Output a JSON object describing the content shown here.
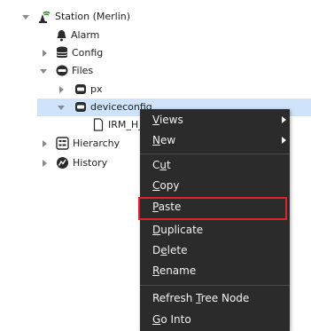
{
  "tree": {
    "station": "Station (Merlin)",
    "alarm": "Alarm",
    "config": "Config",
    "files": "Files",
    "px": "px",
    "deviceconfig": "deviceconfig",
    "irm_file": "IRM_H_",
    "hierarchy": "Hierarchy",
    "history": "History"
  },
  "menu": {
    "views": {
      "pre": "",
      "u": "V",
      "post": "iews"
    },
    "new": {
      "pre": "",
      "u": "N",
      "post": "ew"
    },
    "cut": {
      "pre": "C",
      "u": "u",
      "post": "t"
    },
    "copy": {
      "pre": "",
      "u": "C",
      "post": "opy"
    },
    "paste": {
      "pre": "",
      "u": "P",
      "post": "aste"
    },
    "duplicate": {
      "pre": "",
      "u": "D",
      "post": "uplicate"
    },
    "delete": {
      "pre": "D",
      "u": "e",
      "post": "lete"
    },
    "rename": {
      "pre": "",
      "u": "R",
      "post": "ename"
    },
    "refresh": {
      "pre": "Refresh ",
      "u": "T",
      "post": "ree Node"
    },
    "gointo": {
      "pre": "",
      "u": "G",
      "post": "o Into"
    }
  },
  "colors": {
    "selection": "#cfe4fb",
    "menu_bg": "#2b2b2b",
    "menu_text": "#f2f2f2",
    "highlight_border": "#d9252b"
  },
  "icons": {
    "station": "station-icon",
    "alarm": "bell-icon",
    "config": "database-icon",
    "folder": "folder-icon",
    "file": "file-icon",
    "hierarchy": "hierarchy-icon",
    "history": "history-icon"
  }
}
